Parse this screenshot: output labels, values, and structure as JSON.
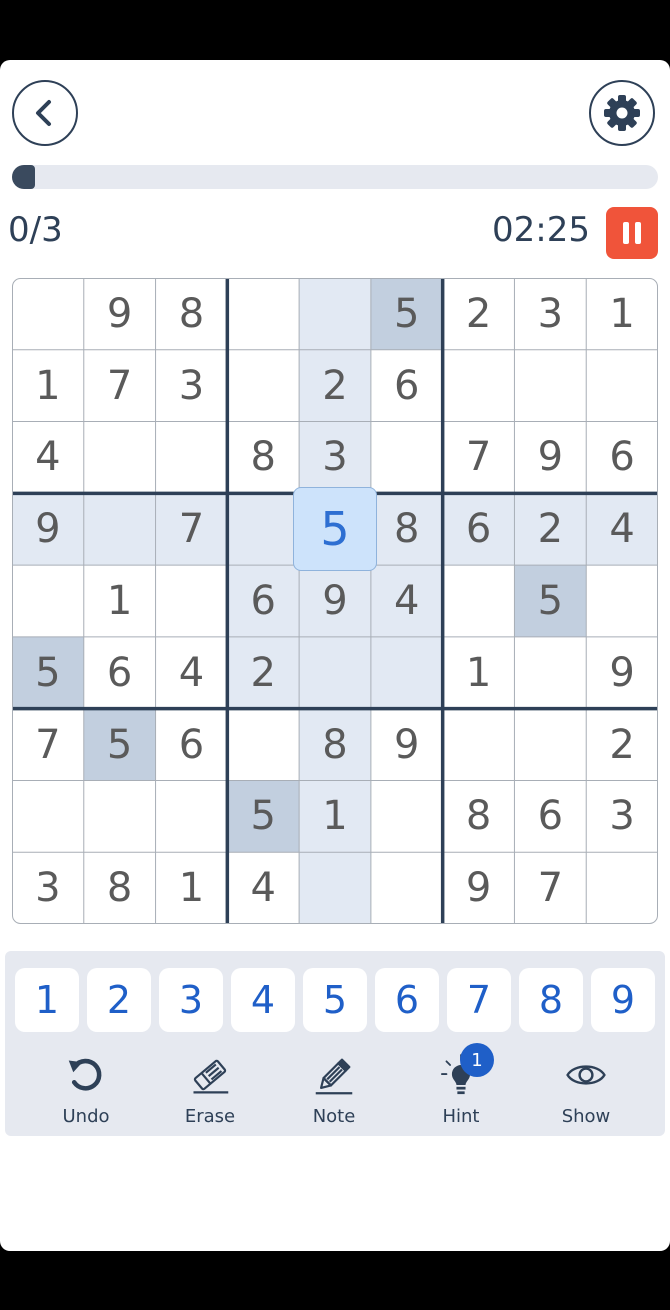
{
  "header": {
    "back_icon": "chevron-left-icon",
    "settings_icon": "gear-icon"
  },
  "progress": {
    "fraction": 0.035
  },
  "status": {
    "mistakes": "0/3",
    "timer": "02:25",
    "pause_icon": "pause-icon"
  },
  "colors": {
    "accent": "#1f5fc8",
    "pause": "#f0543a",
    "highlight": "#e2e9f3",
    "same_number": "#c2cfdf",
    "selected": "#cde3fb",
    "grid_thick": "#2e4057"
  },
  "board": {
    "selected": {
      "row": 3,
      "col": 4
    },
    "rows": [
      [
        "",
        "9",
        "8",
        "",
        "",
        "5",
        "2",
        "3",
        "1"
      ],
      [
        "1",
        "7",
        "3",
        "",
        "2",
        "6",
        "",
        "",
        ""
      ],
      [
        "4",
        "",
        "",
        "8",
        "3",
        "",
        "7",
        "9",
        "6"
      ],
      [
        "9",
        "",
        "7",
        "",
        "5",
        "8",
        "6",
        "2",
        "4"
      ],
      [
        "",
        "1",
        "",
        "6",
        "9",
        "4",
        "",
        "5",
        ""
      ],
      [
        "5",
        "6",
        "4",
        "2",
        "",
        "",
        "1",
        "",
        "9"
      ],
      [
        "7",
        "5",
        "6",
        "",
        "8",
        "9",
        "",
        "",
        "2"
      ],
      [
        "",
        "",
        "",
        "5",
        "1",
        "",
        "8",
        "6",
        "3"
      ],
      [
        "3",
        "8",
        "1",
        "4",
        "",
        "",
        "9",
        "7",
        ""
      ]
    ]
  },
  "numpad": [
    "1",
    "2",
    "3",
    "4",
    "5",
    "6",
    "7",
    "8",
    "9"
  ],
  "tools": [
    {
      "label": "Undo",
      "icon": "undo-icon"
    },
    {
      "label": "Erase",
      "icon": "eraser-icon"
    },
    {
      "label": "Note",
      "icon": "pencil-icon"
    },
    {
      "label": "Hint",
      "icon": "lightbulb-icon",
      "badge": "1"
    },
    {
      "label": "Show",
      "icon": "eye-icon"
    }
  ]
}
